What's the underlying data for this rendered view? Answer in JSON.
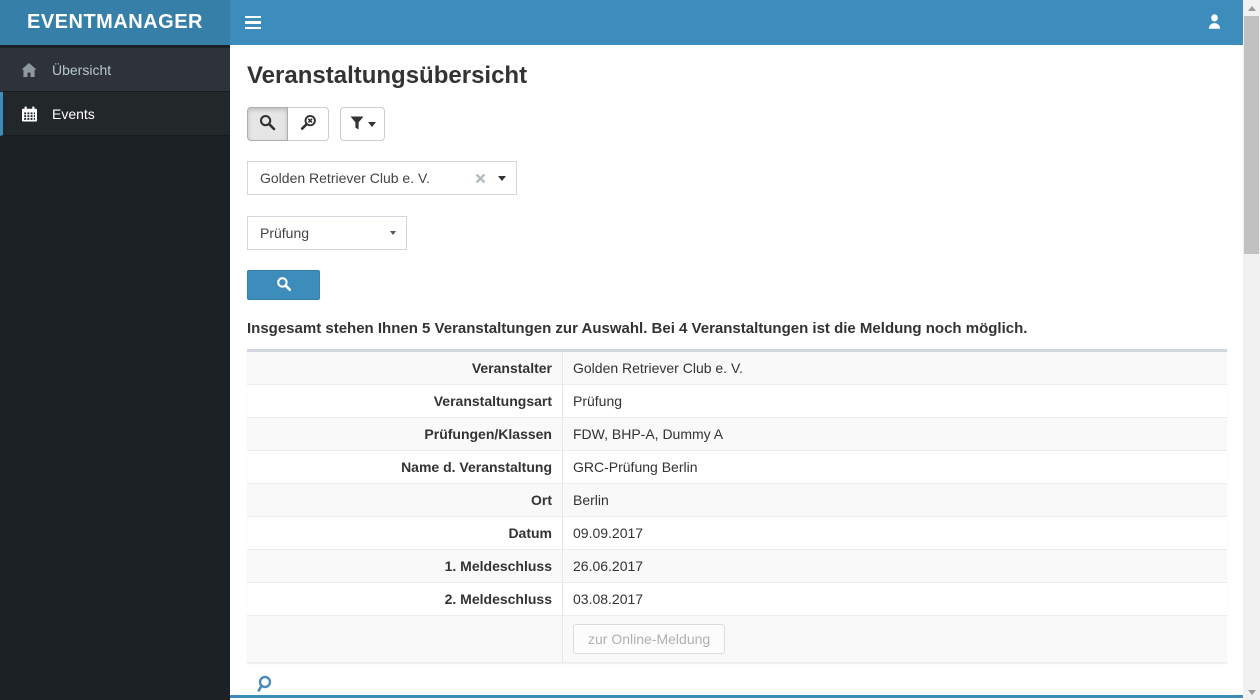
{
  "app": {
    "brand": "EVENTMANAGER"
  },
  "navbar": {
    "menu_toggle_icon": "hamburger-icon",
    "user_icon": "user-icon"
  },
  "sidebar": {
    "items": [
      {
        "label": "Übersicht",
        "icon": "home-icon",
        "active": false
      },
      {
        "label": "Events",
        "icon": "calendar-icon",
        "active": true
      }
    ]
  },
  "page": {
    "title": "Veranstaltungsübersicht"
  },
  "toolbar": {
    "buttons": [
      {
        "name": "show-search",
        "icon": "search-icon",
        "active": true
      },
      {
        "name": "clear-search",
        "icon": "search-clear-icon",
        "active": false
      },
      {
        "name": "filter-menu",
        "icon": "filter-icon",
        "has_caret": true,
        "active": false
      }
    ]
  },
  "filters": {
    "organizer_select": {
      "value": "Golden Retriever Club e. V.",
      "clearable": true
    },
    "type_select": {
      "value": "Prüfung"
    }
  },
  "search": {
    "submit_icon": "search-icon"
  },
  "summary": {
    "text": "Insgesamt stehen Ihnen 5 Veranstaltungen zur Auswahl. Bei 4 Veranstaltungen ist die Meldung noch möglich.",
    "total_events": 5,
    "open_events": 4
  },
  "event": {
    "rows": [
      {
        "label": "Veranstalter",
        "value": "Golden Retriever Club e. V."
      },
      {
        "label": "Veranstaltungsart",
        "value": "Prüfung"
      },
      {
        "label": "Prüfungen/Klassen",
        "value": "FDW, BHP-A, Dummy A"
      },
      {
        "label": "Name d. Veranstaltung",
        "value": "GRC-Prüfung Berlin"
      },
      {
        "label": "Ort",
        "value": "Berlin"
      },
      {
        "label": "Datum",
        "value": "09.09.2017"
      },
      {
        "label": "1. Meldeschluss",
        "value": "26.06.2017"
      },
      {
        "label": "2. Meldeschluss",
        "value": "03.08.2017"
      }
    ],
    "action_label": "zur Online-Meldung",
    "action_disabled": true,
    "footer_icon": "search-icon"
  },
  "colors": {
    "navbar": "#3c8dbc",
    "brand_bg": "#367fa9",
    "sidebar_bg": "#1c2125",
    "sidebar_item_bg": "#2d3338",
    "sidebar_active_bg": "#222829",
    "accent": "#3c8dbc",
    "box_border": "#d2d6de",
    "stripe": "#f9f9f9"
  }
}
